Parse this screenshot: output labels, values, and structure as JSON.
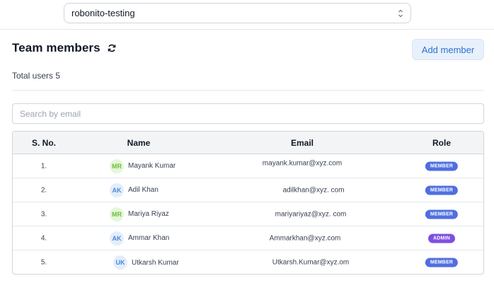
{
  "org": {
    "selected": "robonito-testing"
  },
  "header": {
    "title": "Team members",
    "add_button": "Add member"
  },
  "summary": {
    "total_users": "Total users 5"
  },
  "search": {
    "placeholder": "Search by email"
  },
  "table": {
    "columns": [
      "S. No.",
      "Name",
      "Email",
      "Role"
    ],
    "rows": [
      {
        "sno": "1.",
        "initials": "MR",
        "name": "Mayank Kumar",
        "email": "mayank.kumar@xyz.com",
        "role": "MEMBER"
      },
      {
        "sno": "2.",
        "initials": "AK",
        "name": "Adil Khan",
        "email": "adilkhan@xyz. com",
        "role": "MEMBER"
      },
      {
        "sno": "3.",
        "initials": "MR",
        "name": "Mariya Riyaz",
        "email": "mariyariyaz@xyz. com",
        "role": "MEMBER"
      },
      {
        "sno": "4.",
        "initials": "AK",
        "name": "Ammar Khan",
        "email": "Ammarkhan@xyz.com",
        "role": "ADMIN"
      },
      {
        "sno": "5.",
        "initials": "UK",
        "name": "Utkarsh Kumar",
        "email": "Utkarsh.Kumar@xyz.om",
        "role": "MEMBER"
      }
    ]
  },
  "colors": {
    "avatar_green_bg": "#e6f6dc",
    "avatar_green_fg": "#6bbf3a",
    "avatar_blue_bg": "#e3eefb",
    "avatar_blue_fg": "#4a86d8",
    "member_badge": "#4f6fe0",
    "admin_badge": "#7f4fe0"
  }
}
